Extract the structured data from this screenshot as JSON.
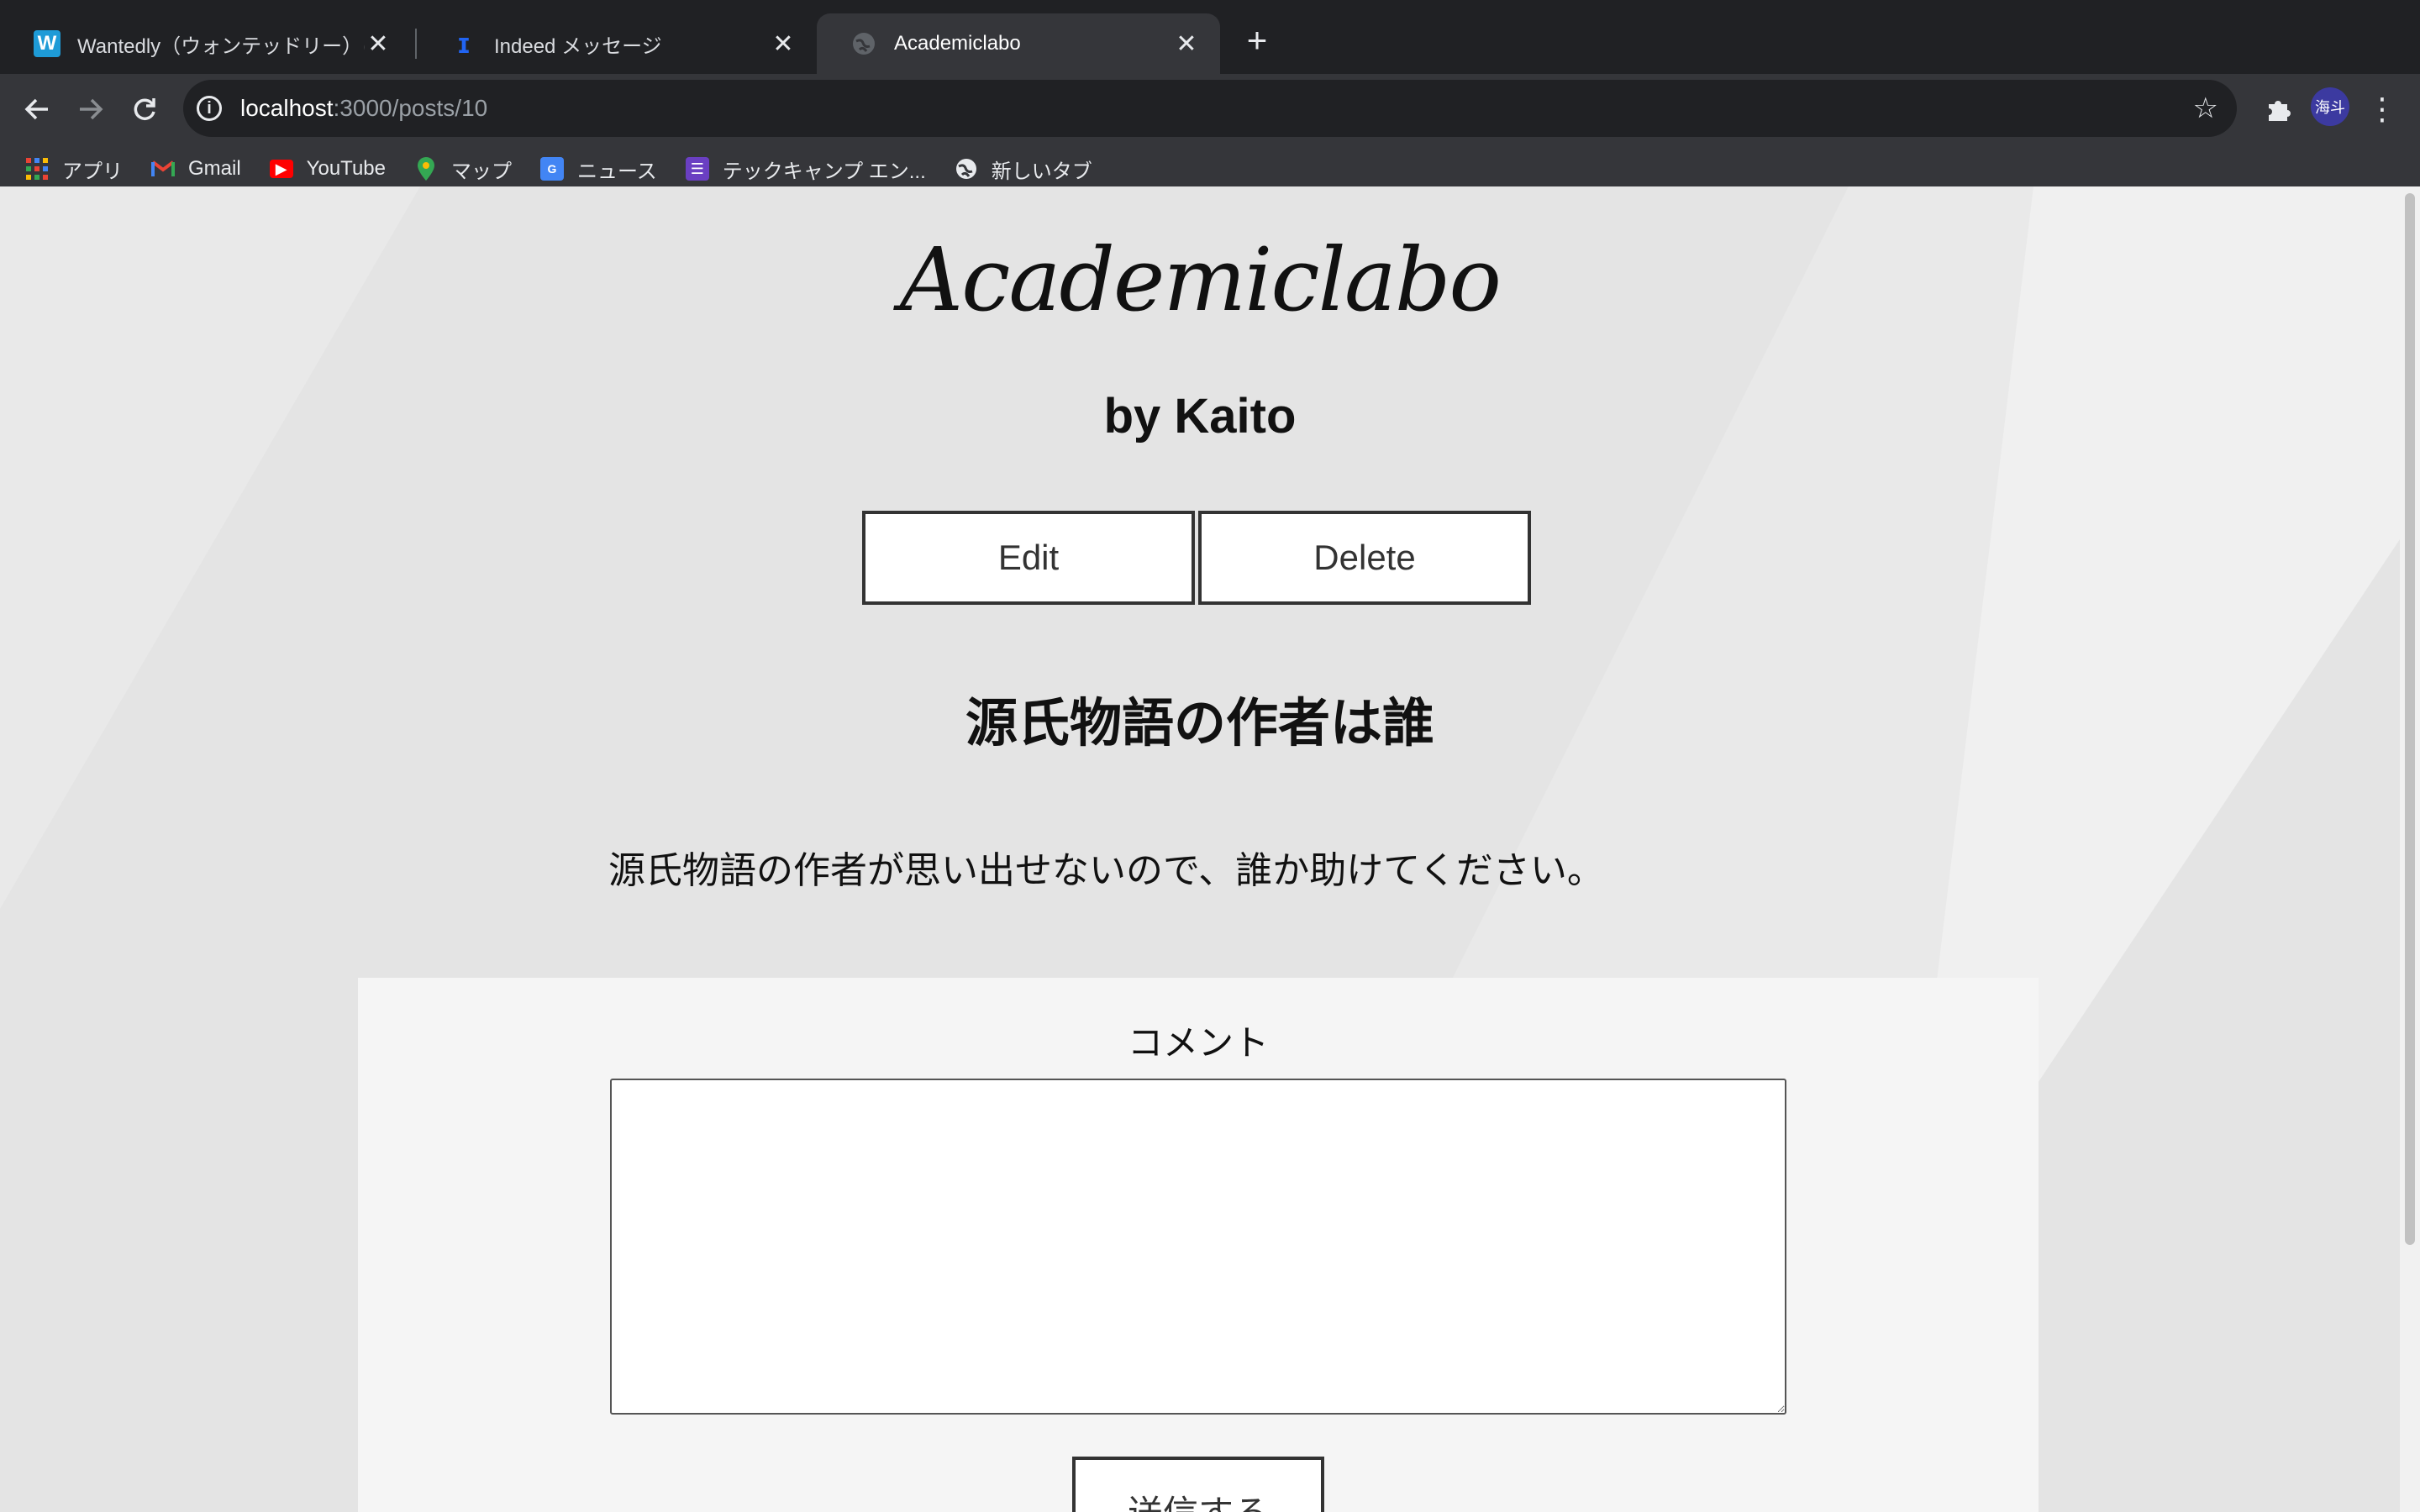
{
  "tabs": [
    {
      "title": "Wantedly（ウォンテッドリー）は",
      "favicon": "W",
      "favicon_color": "#1e9bd7"
    },
    {
      "title": "Indeed メッセージ",
      "favicon": "i",
      "favicon_color": "#2164f3"
    },
    {
      "title": "Academiclabo",
      "favicon": "globe",
      "favicon_color": "#5f6368"
    }
  ],
  "address_bar": {
    "host": "localhost",
    "path": ":3000/posts/10"
  },
  "bookmarks": [
    {
      "label": "アプリ",
      "icon": "apps-grid-icon"
    },
    {
      "label": "Gmail",
      "icon": "gmail-icon"
    },
    {
      "label": "YouTube",
      "icon": "youtube-icon"
    },
    {
      "label": "マップ",
      "icon": "maps-icon"
    },
    {
      "label": "ニュース",
      "icon": "news-icon"
    },
    {
      "label": "テックキャンプ エン...",
      "icon": "list-icon"
    },
    {
      "label": "新しいタブ",
      "icon": "globe-icon"
    }
  ],
  "profile": {
    "avatar_text": "海斗"
  },
  "page": {
    "logo": "Academiclabo",
    "author": "by Kaito",
    "edit_label": "Edit",
    "delete_label": "Delete",
    "post_title": "源氏物語の作者は誰",
    "post_body": "源氏物語の作者が思い出せないので、誰か助けてください。",
    "comment_label": "コメント",
    "comment_value": "",
    "submit_label": "送信する"
  },
  "colors": {
    "chrome_dark": "#202124",
    "chrome_toolbar": "#35363a",
    "page_bg": "#e4e4e4",
    "panel_bg": "#f5f5f5"
  }
}
